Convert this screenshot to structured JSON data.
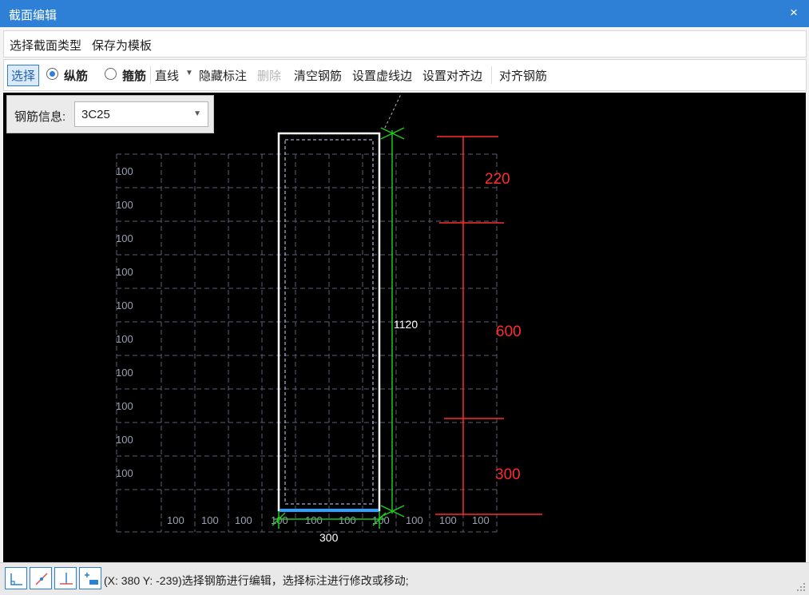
{
  "window": {
    "title": "截面编辑",
    "close_glyph": "×"
  },
  "menu": [
    "选择截面类型",
    "保存为模板"
  ],
  "toolbar": {
    "select": "选择",
    "longitudinal": "纵筋",
    "stirrup": "箍筋",
    "line": "直线",
    "hide_dims": "隐藏标注",
    "delete": "删除",
    "clear_rebar": "清空钢筋",
    "set_dashed_edge": "设置虚线边",
    "set_align_edge": "设置对齐边",
    "align_rebar": "对齐钢筋",
    "selected_mode": "纵筋"
  },
  "rebar_info": {
    "label": "钢筋信息:",
    "value": "3C25"
  },
  "drawing": {
    "grid_label": "100",
    "height_dim": "1120",
    "width_dim": "300",
    "annotations": [
      "220",
      "600",
      "300"
    ],
    "colors": {
      "background": "#000000",
      "grid": "#5a5f72",
      "section": "#ffffff",
      "dim_green": "#1ec81e",
      "annot_red": "#ff2a2a",
      "bottom_edge": "#29a3ff"
    }
  },
  "status": {
    "text": "(X: 380 Y: -239)选择钢筋进行编辑，选择标注进行修改或移动;",
    "tools": [
      "angle-snap-icon",
      "line-snap-icon",
      "perpendicular-icon",
      "origin-icon"
    ]
  }
}
